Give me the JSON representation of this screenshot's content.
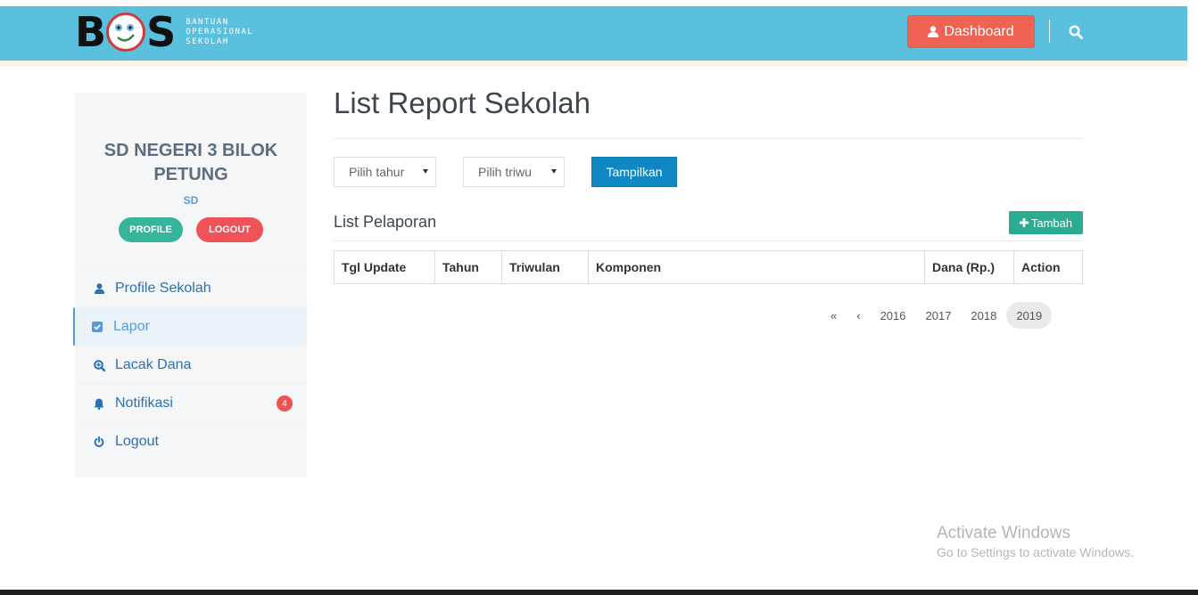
{
  "header": {
    "logo_letters": "BOS",
    "logo_sub": [
      "BANTUAN",
      "OPERASIONAL",
      "SEKOLAH"
    ],
    "dashboard_label": "Dashboard",
    "icons": {
      "dashboard": "user-icon",
      "search": "search-icon"
    },
    "colors": {
      "navbar": "#5bc0de",
      "dashboard_button": "#ef6352"
    }
  },
  "sidebar": {
    "school_name": "SD NEGERI 3 BILOK PETUNG",
    "school_type": "SD",
    "profile_button": "PROFILE",
    "logout_button": "LOGOUT",
    "menu": [
      {
        "label": "Profile Sekolah",
        "icon": "user-icon"
      },
      {
        "label": "Lapor",
        "icon": "checkbox-icon",
        "active": true
      },
      {
        "label": "Lacak Dana",
        "icon": "zoom-in-icon"
      },
      {
        "label": "Notifikasi",
        "icon": "bell-icon",
        "badge": "4"
      },
      {
        "label": "Logout",
        "icon": "power-icon"
      }
    ]
  },
  "main": {
    "title": "List Report Sekolah",
    "filters": {
      "year_select": "Pilih tahur",
      "quarter_select": "Pilih triwu",
      "show_button": "Tampilkan"
    },
    "list_title": "List Pelaporan",
    "add_button": "Tambah",
    "table_headers": [
      "Tgl Update",
      "Tahun",
      "Triwulan",
      "Komponen",
      "Dana (Rp.)",
      "Action"
    ],
    "pagination": {
      "first": "«",
      "prev": "‹",
      "pages": [
        "2016",
        "2017",
        "2018",
        "2019"
      ],
      "active_page": "2019"
    }
  },
  "watermark": {
    "title": "Activate Windows",
    "subtitle": "Go to Settings to activate Windows."
  }
}
